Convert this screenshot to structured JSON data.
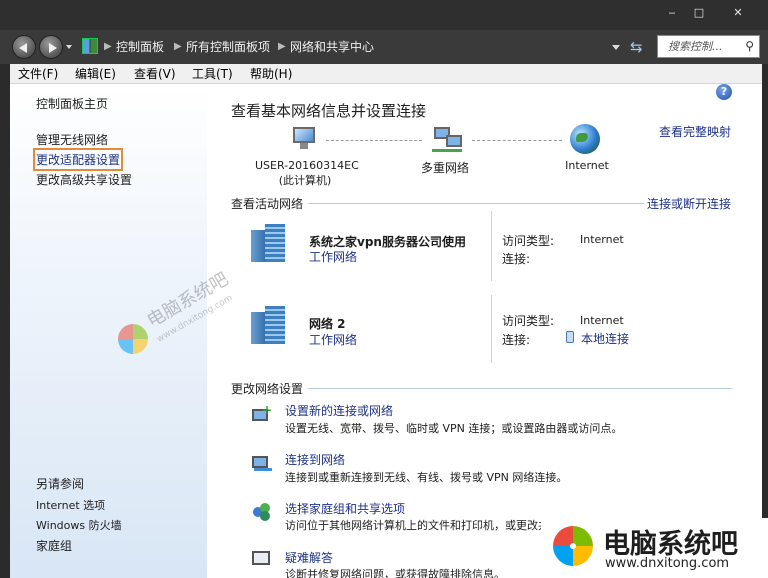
{
  "window": {
    "minimize_glyph": "‒",
    "maximize_glyph": "□",
    "close_glyph": "✕"
  },
  "address": {
    "breadcrumb": [
      "控制面板",
      "所有控制面板项",
      "网络和共享中心"
    ],
    "search_placeholder": "搜索控制..."
  },
  "menu": [
    "文件(F)",
    "编辑(E)",
    "查看(V)",
    "工具(T)",
    "帮助(H)"
  ],
  "sidebar": {
    "home": "控制面板主页",
    "links": [
      "管理无线网络",
      "更改适配器设置",
      "更改高级共享设置"
    ],
    "see_also_title": "另请参阅",
    "see_also": [
      "Internet 选项",
      "Windows 防火墙",
      "家庭组"
    ]
  },
  "main": {
    "title": "查看基本网络信息并设置连接",
    "full_map": "查看完整映射",
    "map": {
      "computer": "USER-20160314EC",
      "computer_sub": "(此计算机)",
      "middle": "多重网络",
      "internet": "Internet"
    },
    "active_header": "查看活动网络",
    "connect_link": "连接或断开连接",
    "networks": [
      {
        "name": "系统之家vpn服务器公司使用",
        "type": "工作网络",
        "access_label": "访问类型:",
        "access_value": "Internet",
        "conn_label": "连接:",
        "conn_value": ""
      },
      {
        "name": "网络  2",
        "type": "工作网络",
        "access_label": "访问类型:",
        "access_value": "Internet",
        "conn_label": "连接:",
        "conn_value": "本地连接"
      }
    ],
    "change_header": "更改网络设置",
    "tasks": [
      {
        "link": "设置新的连接或网络",
        "desc": "设置无线、宽带、拨号、临时或 VPN 连接；或设置路由器或访问点。"
      },
      {
        "link": "连接到网络",
        "desc": "连接到或重新连接到无线、有线、拨号或 VPN 网络连接。"
      },
      {
        "link": "选择家庭组和共享选项",
        "desc": "访问位于其他网络计算机上的文件和打印机，或更改共享设置。"
      },
      {
        "link": "疑难解答",
        "desc": "诊断并修复网络问题，或获得故障排除信息。"
      }
    ]
  },
  "watermark": {
    "text": "电脑系统吧",
    "url": "www.dnxitong.com"
  },
  "brand": {
    "text": "电脑系统吧",
    "url": "www.dnxitong.com"
  },
  "colors": {
    "link": "#1e3287",
    "highlight_box": "#e5893a",
    "titlebar": "#2f2f2f"
  }
}
